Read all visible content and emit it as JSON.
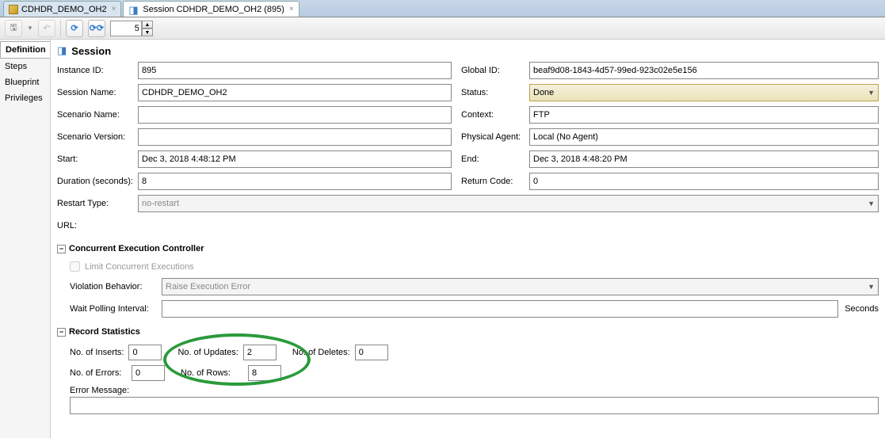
{
  "tabs": [
    {
      "label": "CDHDR_DEMO_OH2"
    },
    {
      "label": "Session CDHDR_DEMO_OH2 (895)"
    }
  ],
  "toolbar": {
    "spinner_value": "5"
  },
  "sidebar": {
    "items": [
      {
        "label": "Definition"
      },
      {
        "label": "Steps"
      },
      {
        "label": "Blueprint"
      },
      {
        "label": "Privileges"
      }
    ]
  },
  "header": {
    "title": "Session"
  },
  "form": {
    "instance_id_label": "Instance ID:",
    "instance_id": "895",
    "global_id_label": "Global ID:",
    "global_id": "beaf9d08-1843-4d57-99ed-923c02e5e156",
    "session_name_label": "Session Name:",
    "session_name": "CDHDR_DEMO_OH2",
    "status_label": "Status:",
    "status": "Done",
    "scenario_name_label": "Scenario Name:",
    "scenario_name": "",
    "context_label": "Context:",
    "context": "FTP",
    "scenario_version_label": "Scenario Version:",
    "scenario_version": "",
    "physical_agent_label": "Physical Agent:",
    "physical_agent": "Local (No Agent)",
    "start_label": "Start:",
    "start": "Dec 3, 2018 4:48:12 PM",
    "end_label": "End:",
    "end": "Dec 3, 2018 4:48:20 PM",
    "duration_label": "Duration (seconds):",
    "duration": "8",
    "return_code_label": "Return Code:",
    "return_code": "0",
    "restart_type_label": "Restart Type:",
    "restart_type": "no-restart",
    "url_label": "URL:"
  },
  "groups": {
    "cec": {
      "title": "Concurrent Execution Controller",
      "limit_label": "Limit Concurrent Executions",
      "violation_label": "Violation Behavior:",
      "violation_value": "Raise Execution Error",
      "wait_label": "Wait Polling Interval:",
      "wait_unit": "Seconds"
    },
    "stats": {
      "title": "Record Statistics",
      "inserts_label": "No. of Inserts:",
      "inserts": "0",
      "updates_label": "No. of Updates:",
      "updates": "2",
      "deletes_label": "No. of Deletes:",
      "deletes": "0",
      "errors_label": "No. of Errors:",
      "errors": "0",
      "rows_label": "No. of Rows:",
      "rows": "8",
      "errmsg_label": "Error Message:"
    }
  }
}
